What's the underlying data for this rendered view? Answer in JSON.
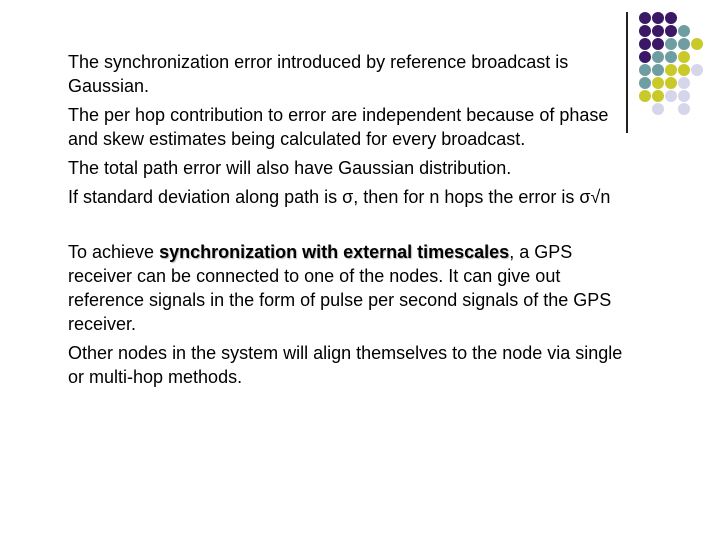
{
  "decoration": {
    "colors": {
      "purple": "#3b1866",
      "teal": "#6f9ea2",
      "yellow": "#c9c92a",
      "lavender": "#d6d6ea"
    },
    "dot_grid": [
      [
        "purple",
        "purple",
        "purple",
        null,
        null
      ],
      [
        "purple",
        "purple",
        "purple",
        "teal",
        null
      ],
      [
        "purple",
        "purple",
        "teal",
        "teal",
        "yellow"
      ],
      [
        "purple",
        "teal",
        "teal",
        "yellow",
        null
      ],
      [
        "teal",
        "teal",
        "yellow",
        "yellow",
        "lavender"
      ],
      [
        "teal",
        "yellow",
        "yellow",
        "lavender",
        null
      ],
      [
        "yellow",
        "yellow",
        "lavender",
        "lavender",
        null
      ],
      [
        null,
        "lavender",
        null,
        "lavender",
        null
      ]
    ]
  },
  "body": {
    "paragraphs": [
      "The synchronization error introduced by reference broadcast is Gaussian.",
      "The per hop contribution to error are independent because of phase and skew estimates being calculated for every broadcast.",
      "The total path error will also have Gaussian distribution.",
      "If standard deviation along path is σ, then for n hops the error is σ√n"
    ],
    "gps_paragraph": {
      "prefix": "To achieve ",
      "emphasis": "synchronization with external timescales",
      "suffix": ", a GPS receiver can be connected to one of the nodes. It can give out reference signals in the form of pulse per second signals of the GPS receiver."
    },
    "final_paragraph": "Other nodes in the system will align themselves to the node via single or multi-hop methods."
  }
}
